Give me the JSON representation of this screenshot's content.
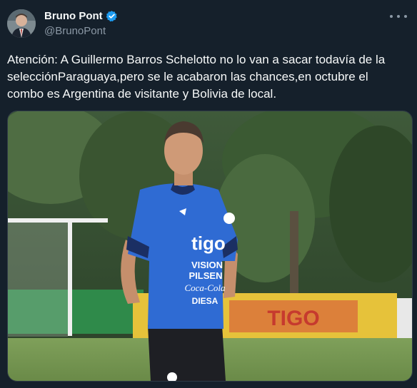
{
  "author": {
    "name": "Bruno Pont",
    "handle": "@BrunoPont"
  },
  "tweet": {
    "lines": [
      "Atención: A Guillermo Barros Schelotto no lo van a sacar todavía de la",
      "selecciónParaguaya,pero se le acabaron las chances,en octubre el",
      "combo es Argentina de visitante y Bolivia de local."
    ]
  },
  "photo": {
    "shirt_text": [
      "tigo",
      "VISION",
      "PILSEN",
      "Coca-Cola",
      "DIESA"
    ],
    "ad_board_text": "TIGO"
  },
  "colors": {
    "background": "#15202b",
    "verified_badge": "#1d9bf0",
    "jersey": "#2f6bd3"
  }
}
